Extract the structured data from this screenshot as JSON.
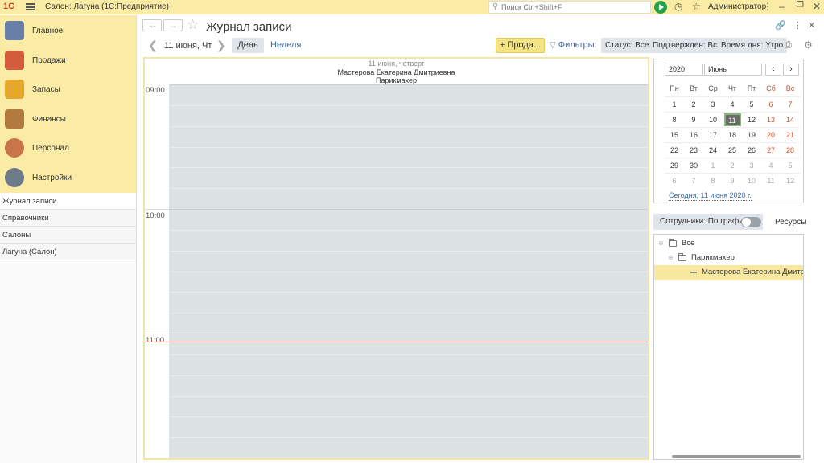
{
  "titlebar": {
    "logo": "1С",
    "app_title": "Салон: Лагуна  (1С:Предприятие)",
    "search_placeholder": "Поиск Ctrl+Shift+F",
    "user": "Администратор"
  },
  "sidebar": {
    "sections": [
      {
        "label": "Главное",
        "icon": "clipboard-icon",
        "color": "#6a7fa8"
      },
      {
        "label": "Продажи",
        "icon": "sales-chart-icon",
        "color": "#d35c3d"
      },
      {
        "label": "Запасы",
        "icon": "inventory-icon",
        "color": "#e6a82c"
      },
      {
        "label": "Финансы",
        "icon": "wallet-icon",
        "color": "#b37a3e"
      },
      {
        "label": "Персонал",
        "icon": "staff-icon",
        "color": "#c9754b"
      },
      {
        "label": "Настройки",
        "icon": "gear-icon",
        "color": "#6e7c8a"
      }
    ],
    "subitems": [
      "Журнал записи",
      "Справочники",
      "Салоны",
      "Лагуна (Салон)"
    ]
  },
  "header": {
    "title": "Журнал записи"
  },
  "toolbar": {
    "date": "11 июня, Чт",
    "day_label": "День",
    "week_label": "Неделя",
    "sale_label": "+ Прода...",
    "filters_label": "Фильтры:",
    "chips": [
      "Статус: Все",
      "Подтвержден: Все",
      "Время дня: Утро"
    ]
  },
  "schedule": {
    "date_label": "11 июня, четверг",
    "employee": "Мастерова Екатерина Дмитриевна",
    "role": "Парикмахер",
    "times": [
      "09:00",
      "10:00",
      "11:00"
    ]
  },
  "calendar": {
    "year": "2020",
    "month": "Июнь",
    "weekdays": [
      "Пн",
      "Вт",
      "Ср",
      "Чт",
      "Пт",
      "Сб",
      "Вс"
    ],
    "weeks": [
      [
        "1",
        "2",
        "3",
        "4",
        "5",
        "6",
        "7"
      ],
      [
        "8",
        "9",
        "10",
        "11",
        "12",
        "13",
        "14"
      ],
      [
        "15",
        "16",
        "17",
        "18",
        "19",
        "20",
        "21"
      ],
      [
        "22",
        "23",
        "24",
        "25",
        "26",
        "27",
        "28"
      ],
      [
        "29",
        "30",
        "1",
        "2",
        "3",
        "4",
        "5"
      ],
      [
        "6",
        "7",
        "8",
        "9",
        "10",
        "11",
        "12"
      ]
    ],
    "selected": "11",
    "today_link": "Сегодня, 11 июня 2020 г."
  },
  "employees": {
    "schedule_label": "Сотрудники: По графику",
    "resources_label": "Ресурсы",
    "tree": [
      {
        "label": "Все",
        "level": 0,
        "type": "folder"
      },
      {
        "label": "Парикмахер",
        "level": 1,
        "type": "folder"
      },
      {
        "label": "Мастерова Екатерина Дмитриевна",
        "level": 2,
        "type": "item",
        "selected": true
      }
    ]
  },
  "colors": {
    "accent_yellow": "#fbeca5",
    "link_blue": "#3d6aa5",
    "weekend_red": "#d2502c",
    "now_line": "#c64537",
    "grid_bg": "#dde3e3"
  }
}
